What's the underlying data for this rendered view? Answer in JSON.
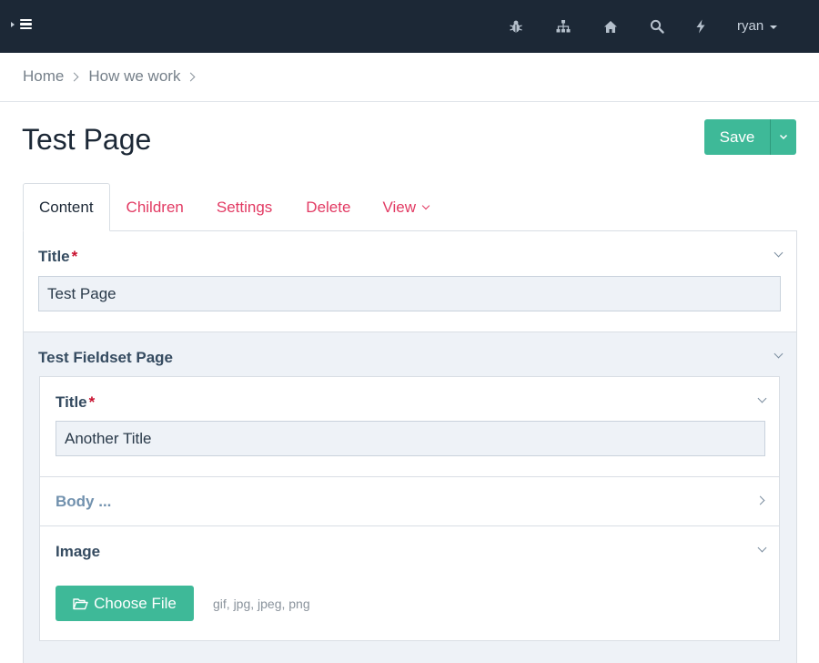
{
  "navbar": {
    "user": "ryan",
    "icons": [
      "bug-icon",
      "sitemap-icon",
      "home-icon",
      "search-icon",
      "bolt-icon"
    ]
  },
  "breadcrumb": {
    "items": [
      "Home",
      "How we work"
    ]
  },
  "page": {
    "title": "Test Page",
    "save_label": "Save"
  },
  "tabs": [
    {
      "label": "Content",
      "active": true
    },
    {
      "label": "Children"
    },
    {
      "label": "Settings"
    },
    {
      "label": "Delete"
    },
    {
      "label": "View"
    }
  ],
  "content": {
    "title_label": "Title",
    "required_mark": "*",
    "title_value": "Test Page",
    "fieldset": {
      "label": "Test Fieldset Page",
      "title_label": "Title",
      "title_value": "Another Title",
      "body_label": "Body ...",
      "image_label": "Image",
      "choose_file_label": "Choose File",
      "file_types": "gif, jpg, jpeg, png"
    }
  },
  "colors": {
    "navbar_bg": "#1c2836",
    "accent_green": "#3eb998",
    "tab_link": "#e23a63",
    "input_bg": "#eef2f7"
  }
}
